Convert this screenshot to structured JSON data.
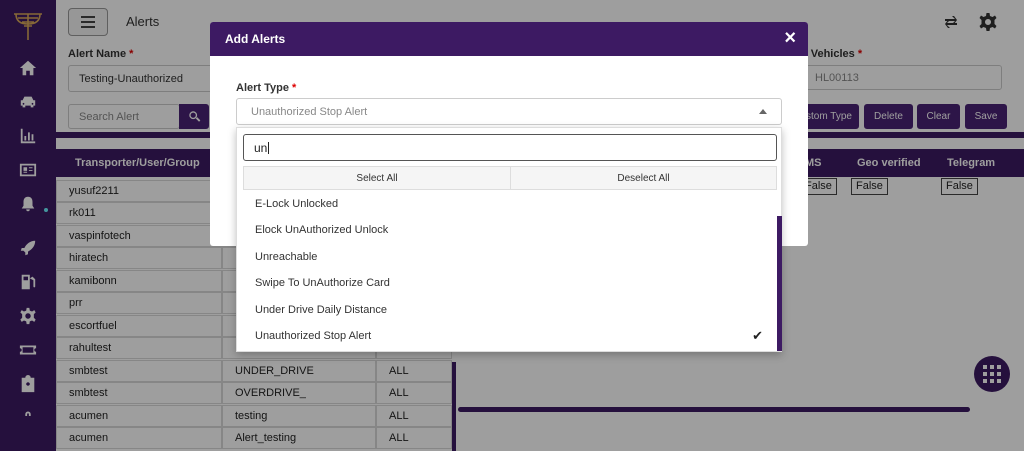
{
  "page": {
    "title": "Alerts"
  },
  "filters": {
    "alert_name_label": "Alert Name",
    "alert_name_value": "Testing-Unauthorized",
    "vehicles_label": "t Vehicles",
    "vehicles_value": "HL00113",
    "search_placeholder": "Search Alert"
  },
  "actions": {
    "custom_type": "stom Type",
    "delete": "Delete",
    "clear": "Clear",
    "save": "Save"
  },
  "table": {
    "headers": {
      "col1": "Transporter/User/Group",
      "col_sms": "MS",
      "col_geo": "Geo verified",
      "col_telegram": "Telegram"
    },
    "false_label": "False",
    "rows": [
      {
        "user": "yusuf2211",
        "alert": "",
        "scope": ""
      },
      {
        "user": "rk011",
        "alert": "",
        "scope": ""
      },
      {
        "user": "vaspinfotech",
        "alert": "",
        "scope": ""
      },
      {
        "user": "hiratech",
        "alert": "",
        "scope": ""
      },
      {
        "user": "kamibonn",
        "alert": "",
        "scope": ""
      },
      {
        "user": "prr",
        "alert": "",
        "scope": ""
      },
      {
        "user": "escortfuel",
        "alert": "",
        "scope": ""
      },
      {
        "user": "rahultest",
        "alert": "",
        "scope": ""
      },
      {
        "user": "smbtest",
        "alert": "UNDER_DRIVE",
        "scope": "ALL"
      },
      {
        "user": "smbtest",
        "alert": "OVERDRIVE_",
        "scope": "ALL"
      },
      {
        "user": "acumen",
        "alert": "testing",
        "scope": "ALL"
      },
      {
        "user": "acumen",
        "alert": "Alert_testing",
        "scope": "ALL"
      }
    ]
  },
  "modal": {
    "title": "Add Alerts",
    "close": "×",
    "alert_type_label": "Alert Type",
    "required_mark": "*",
    "alert_type_value": "Unauthorized Stop Alert"
  },
  "dropdown": {
    "search_value": "un",
    "select_all": "Select All",
    "deselect_all": "Deselect All",
    "check_mark": "✔",
    "options": [
      {
        "label": "E-Lock Unlocked",
        "selected": false
      },
      {
        "label": "Elock UnAuthorized Unlock",
        "selected": false
      },
      {
        "label": "Unreachable",
        "selected": false
      },
      {
        "label": "Swipe To UnAuthorize Card",
        "selected": false
      },
      {
        "label": "Under Drive Daily Distance",
        "selected": false
      },
      {
        "label": "Unauthorized Stop Alert",
        "selected": true
      }
    ]
  }
}
